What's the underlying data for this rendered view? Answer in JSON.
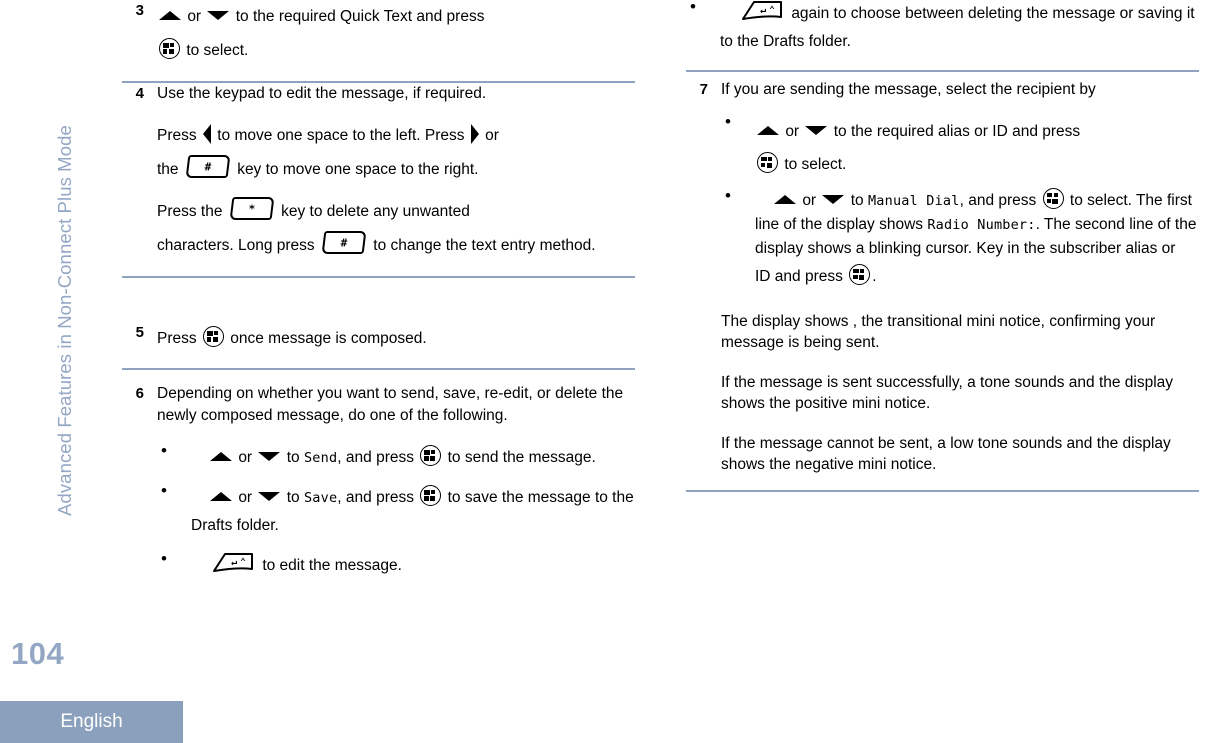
{
  "sidebar": {
    "running_head": "Advanced Features in Non-Connect Plus Mode",
    "page_number": "104",
    "language": "English"
  },
  "colors": {
    "accent": "#8ba0bc",
    "rule": "#8fa3c0",
    "page_number": "#93a7c4",
    "running_head": "#93a7c4",
    "badge_text": "#ffffff",
    "text": "#000000"
  },
  "left_column": {
    "step3": {
      "number": "3",
      "line1_a": "",
      "or": "or",
      "line1_b": "to the required Quick Text and press",
      "line2": "to select."
    },
    "step4": {
      "number": "4",
      "p1": "Use the keypad to edit the message, if required.",
      "p2_a": "Press",
      "p2_b": "to move one space to the left. Press",
      "p2_c": "or",
      "p2_d": "the",
      "p2_e": "key to move one space to the right.",
      "p3_a": "Press the",
      "p3_b": "key to delete any unwanted",
      "p3_c": "characters. Long press",
      "p3_d": "to change the text entry method."
    },
    "step5": {
      "number": "5",
      "a": "Press",
      "b": "once message is composed."
    },
    "step6": {
      "number": "6",
      "p1": "Depending on whether you want to send, save, re-edit, or delete the newly composed message, do one of the following.",
      "bullets": [
        {
          "or": "or",
          "to": "to",
          "target": "Send",
          "and_press": ", and press",
          "tail": "to send the message."
        },
        {
          "or": "or",
          "to": "to",
          "target": "Save",
          "and_press": ", and press",
          "tail": "to save the message to the Drafts folder."
        },
        {
          "tail": "to edit the message."
        }
      ]
    }
  },
  "right_column": {
    "step6_continued": {
      "bullet": {
        "tail": "again to choose between deleting the message or saving it to the Drafts folder."
      }
    },
    "step7": {
      "number": "7",
      "p1": "If you are sending the message, select the recipient by",
      "bullets": [
        {
          "or": "or",
          "to": "to the required alias or ID and press",
          "tail": "to select."
        },
        {
          "or": "or",
          "to": "to",
          "target": "Manual Dial",
          "and_press": ", and press",
          "tail_a": "to select. The first line of the display shows",
          "target2": "Radio Number:",
          "tail_b": ". The second line of the display shows a blinking cursor. Key in the subscriber alias or",
          "tail_c": "ID and press",
          "tail_d": "."
        }
      ],
      "p2": "The display shows , the transitional mini notice, confirming your message is being sent.",
      "p3": "If the message is sent successfully, a tone sounds and the display shows the positive mini notice.",
      "p4": "If the message cannot be sent, a low tone sounds and the display shows the negative mini notice."
    }
  },
  "icons": {
    "up_arrow": "up-triangle-icon",
    "down_arrow": "down-triangle-icon",
    "left_arrow": "left-triangle-icon",
    "right_arrow": "right-triangle-icon",
    "menu": "menu-select-button-icon",
    "hash_key": "hash-key-icon",
    "star_key": "star-delete-key-icon",
    "back_key": "back-home-key-icon",
    "hash_label": "#",
    "star_label": "*"
  }
}
